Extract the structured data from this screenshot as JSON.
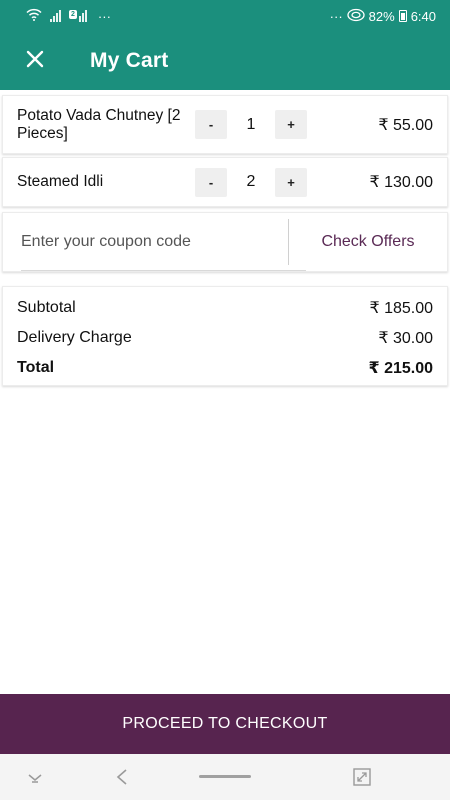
{
  "status_bar": {
    "left_dots": "···",
    "sim_badge": "2",
    "right_dots": "···",
    "battery_percent": "82%",
    "time": "6:40"
  },
  "header": {
    "title": "My Cart",
    "close_icon": "close-icon"
  },
  "cart": {
    "items": [
      {
        "name": "Potato Vada Chutney [2 Pieces]",
        "minus": "-",
        "quantity": "1",
        "plus": "+",
        "price": "₹ 55.00"
      },
      {
        "name": "Steamed Idli",
        "minus": "-",
        "quantity": "2",
        "plus": "+",
        "price": "₹ 130.00"
      }
    ]
  },
  "coupon": {
    "placeholder": "Enter your coupon code",
    "check_offers_label": "Check Offers"
  },
  "summary": {
    "subtotal_label": "Subtotal",
    "subtotal_value": "₹ 185.00",
    "delivery_label": "Delivery Charge",
    "delivery_value": "₹ 30.00",
    "total_label": "Total",
    "total_value": "₹ 215.00"
  },
  "checkout": {
    "label": "PROCEED TO CHECKOUT"
  },
  "colors": {
    "primary": "#1b8f7d",
    "accent": "#57244f"
  }
}
